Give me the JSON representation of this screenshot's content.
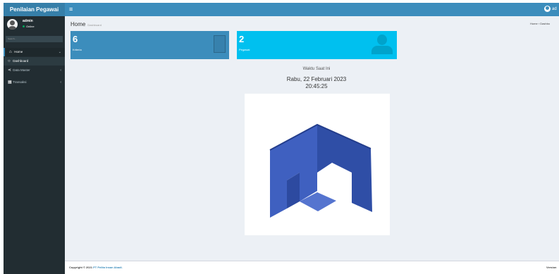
{
  "app": {
    "brand": "Penilaian Pegawai"
  },
  "header": {
    "toggle_icon": "≡",
    "user_short": "ad"
  },
  "sidebar": {
    "user_name": "admin",
    "user_status": "Online",
    "search_placeholder": "Search...",
    "items": [
      {
        "label": "Home",
        "icon": "home-icon"
      },
      {
        "label": "Dashboard",
        "icon": "circle-icon"
      },
      {
        "label": "Data Master",
        "icon": "share-icon"
      },
      {
        "label": "Transaksi",
        "icon": "table-icon"
      }
    ]
  },
  "page": {
    "title": "Home",
    "subtitle": "Dashboard",
    "breadcrumb": "Home › Dashbo"
  },
  "boxes": [
    {
      "value": "6",
      "label": "Kriteria",
      "color": "#3c8dbc"
    },
    {
      "value": "2",
      "label": "Pegawai",
      "color": "#00c0ef"
    }
  ],
  "clock": {
    "label": "Waktu Saat Ini",
    "date": "Rabu, 22 Februari 2023",
    "time": "20:45:25"
  },
  "footer": {
    "copyright": "Copyright © 2021",
    "company": "PT Pelita Insan Abadi.",
    "version": "Version"
  },
  "colors": {
    "header": "#3c8dbc",
    "sidebar": "#222d32",
    "aqua": "#00c0ef",
    "logo": "#3b5cb8"
  }
}
